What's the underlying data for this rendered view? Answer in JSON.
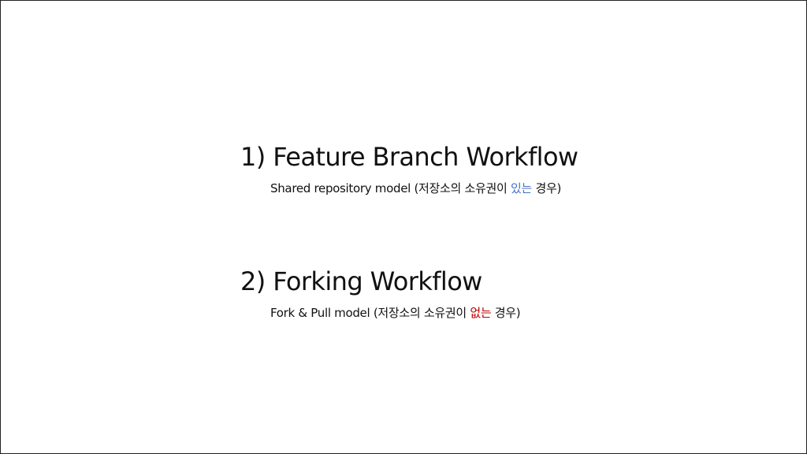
{
  "colors": {
    "text": "#111111",
    "accent_blue": "#4472c4",
    "accent_red": "#c00000",
    "background": "#ffffff"
  },
  "sections": [
    {
      "heading": "1) Feature Branch Workflow",
      "subtitle_before": "Shared repository model (저장소의 소유권이 ",
      "subtitle_highlight": "있는",
      "subtitle_after": " 경우)"
    },
    {
      "heading": "2) Forking Workflow",
      "subtitle_before": "Fork & Pull model (저장소의 소유권이 ",
      "subtitle_highlight": "없는",
      "subtitle_after": " 경우)"
    }
  ]
}
